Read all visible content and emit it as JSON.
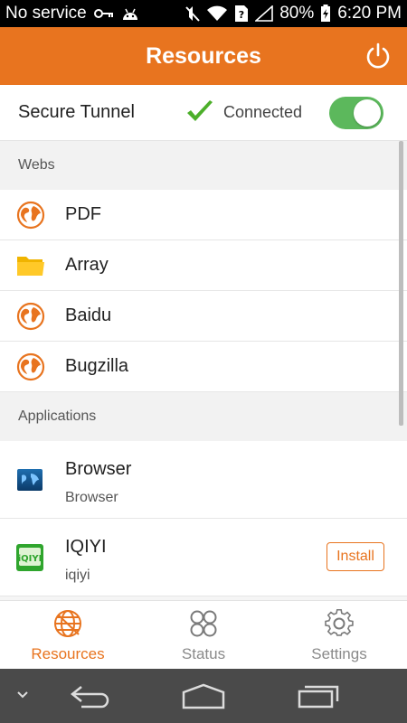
{
  "status_bar": {
    "carrier": "No service",
    "battery": "80%",
    "time": "6:20 PM"
  },
  "app_bar": {
    "title": "Resources"
  },
  "tunnel": {
    "label": "Secure Tunnel",
    "status": "Connected",
    "enabled": true
  },
  "webs": {
    "header": "Webs",
    "items": [
      {
        "label": "PDF",
        "icon": "globe-icon"
      },
      {
        "label": "Array",
        "icon": "folder-icon"
      },
      {
        "label": "Baidu",
        "icon": "globe-icon"
      },
      {
        "label": "Bugzilla",
        "icon": "globe-icon"
      }
    ]
  },
  "applications": {
    "header": "Applications",
    "items": [
      {
        "name": "Browser",
        "subtitle": "Browser",
        "icon": "browser-app-icon"
      },
      {
        "name": "IQIYI",
        "subtitle": "iqiyi",
        "icon": "iqiyi-app-icon",
        "action": "Install"
      }
    ]
  },
  "tabs": [
    {
      "label": "Resources",
      "icon": "globe-icon",
      "active": true
    },
    {
      "label": "Status",
      "icon": "status-grid-icon",
      "active": false
    },
    {
      "label": "Settings",
      "icon": "gear-icon",
      "active": false
    }
  ],
  "colors": {
    "accent": "#e8741f",
    "toggle_on": "#5cb85c",
    "check": "#4caf2a"
  }
}
